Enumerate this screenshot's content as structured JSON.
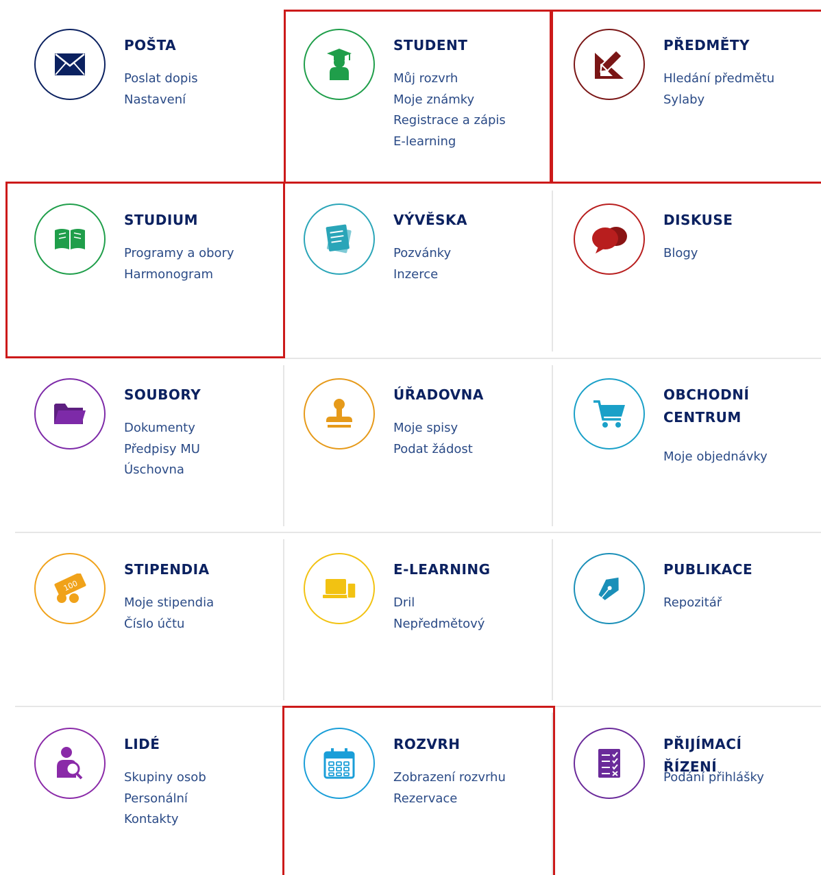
{
  "tiles": [
    {
      "title": "POŠTA",
      "icon": "envelope-icon",
      "color": "#0b2160",
      "links": [
        "Poslat dopis",
        "Nastavení"
      ]
    },
    {
      "title": "STUDENT",
      "icon": "graduate-icon",
      "color": "#1f9e4a",
      "links": [
        "Můj rozvrh",
        "Moje známky",
        "Registrace a zápis",
        "E-learning"
      ]
    },
    {
      "title": "PŘEDMĚTY",
      "icon": "pencil-ruler-icon",
      "color": "#7a1616",
      "links": [
        "Hledání předmětu",
        "Sylaby"
      ]
    },
    {
      "title": "STUDIUM",
      "icon": "book-icon",
      "color": "#1f9e4a",
      "links": [
        "Programy a obory",
        "Harmonogram"
      ]
    },
    {
      "title": "VÝVĚSKA",
      "icon": "notes-icon",
      "color": "#2aa5b8",
      "links": [
        "Pozvánky",
        "Inzerce"
      ]
    },
    {
      "title": "DISKUSE",
      "icon": "chat-bubbles-icon",
      "color": "#b81e1e",
      "links": [
        "Blogy"
      ]
    },
    {
      "title": "SOUBORY",
      "icon": "folder-icon",
      "color": "#7d2aa8",
      "links": [
        "Dokumenty",
        "Předpisy MU",
        "Úschovna"
      ]
    },
    {
      "title": "ÚŘADOVNA",
      "icon": "stamp-icon",
      "color": "#e69a1a",
      "links": [
        "Moje spisy",
        "Podat žádost"
      ]
    },
    {
      "title": "OBCHODNÍ CENTRUM",
      "icon": "cart-icon",
      "color": "#1aa0c8",
      "links": [
        "Moje objednávky"
      ]
    },
    {
      "title": "STIPENDIA",
      "icon": "money-icon",
      "color": "#f0a21a",
      "links": [
        "Moje stipendia",
        "Číslo účtu"
      ]
    },
    {
      "title": "E-LEARNING",
      "icon": "devices-icon",
      "color": "#f2c212",
      "links": [
        "Dril",
        "Nepředmětový"
      ]
    },
    {
      "title": "PUBLIKACE",
      "icon": "pen-nib-icon",
      "color": "#1a8fb8",
      "links": [
        "Repozitář"
      ]
    },
    {
      "title": "LIDÉ",
      "icon": "person-search-icon",
      "color": "#8a2aa8",
      "links": [
        "Skupiny osob",
        "Personální",
        "Kontakty"
      ]
    },
    {
      "title": "ROZVRH",
      "icon": "calendar-icon",
      "color": "#1a9ed8",
      "links": [
        "Zobrazení rozvrhu",
        "Rezervace"
      ]
    },
    {
      "title": "PŘIJÍMACÍ ŘÍZENÍ",
      "icon": "checklist-icon",
      "color": "#6a2a9a",
      "links": [
        "Podání přihlášky"
      ]
    }
  ],
  "highlight_color": "#cc1a1a",
  "highlighted_tiles": [
    "STUDENT",
    "PŘEDMĚTY",
    "STUDIUM",
    "ROZVRH"
  ]
}
